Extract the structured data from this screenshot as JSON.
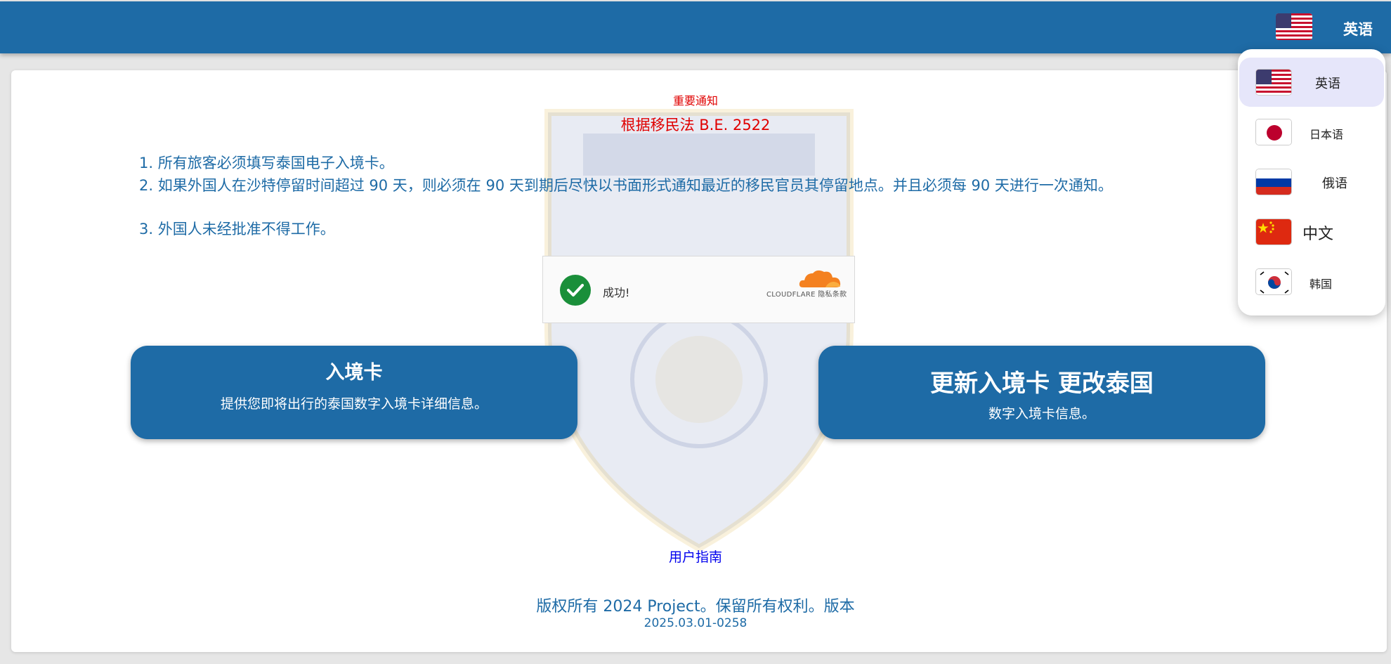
{
  "header": {
    "current_language": "英语",
    "current_flag_icon": "us-flag-icon",
    "background_color": "#1e6ba6"
  },
  "language_menu": {
    "items": [
      {
        "label": "英语",
        "icon": "us-flag-icon",
        "active": true
      },
      {
        "label": "日本语",
        "icon": "japan-flag-icon",
        "active": false
      },
      {
        "label": "俄语",
        "icon": "russia-flag-icon",
        "active": false
      },
      {
        "label": "中文",
        "icon": "china-flag-icon",
        "active": false
      },
      {
        "label": "韩国",
        "icon": "korea-flag-icon",
        "active": false
      }
    ]
  },
  "notice": {
    "small": "重要通知",
    "large": "根据移民法 B.E. 2522",
    "color": "#e00000"
  },
  "rules": [
    "1. 所有旅客必须填写泰国电子入境卡。",
    "2. 如果外国人在沙特停留时间超过 90 天，则必须在 90 天到期后尽快以书面形式通知最近的移民官员其停留地点。并且必须每 90 天进行一次通知。",
    "3. 外国人未经批准不得工作。"
  ],
  "captcha": {
    "status": "成功!",
    "provider": "CLOUDFLARE 隐私条款",
    "success_color": "#1a8f3a"
  },
  "buttons": {
    "arrival_card": {
      "title": "入境卡",
      "description": "提供您即将出行的泰国数字入境卡详细信息。"
    },
    "update_card": {
      "title": "更新入境卡 更改泰国",
      "description": "数字入境卡信息。"
    }
  },
  "footer": {
    "guide_link": "用户指南",
    "copyright": "版权所有 2024 Project。保留所有权利。版本",
    "version": "2025.03.01-0258"
  }
}
